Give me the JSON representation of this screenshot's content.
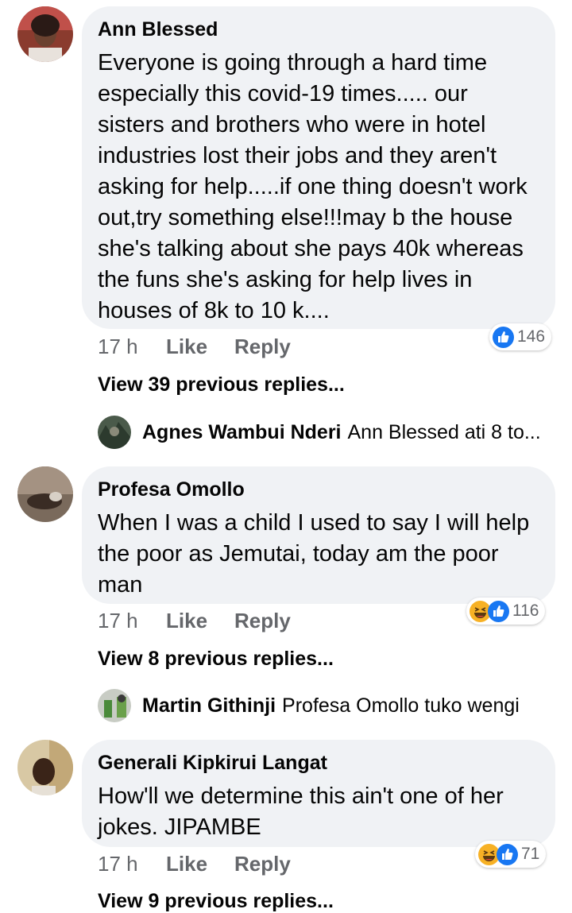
{
  "comments": [
    {
      "author": "Ann Blessed",
      "text": "Everyone is going through a hard time especially this covid-19 times..... our sisters and brothers who were in hotel industries lost their jobs and they aren't asking for help.....if one thing doesn't work out,try something else!!!may b the house she's talking about she pays 40k whereas the funs she's asking for help lives in houses of 8k to 10 k....",
      "time": "17 h",
      "like_label": "Like",
      "reply_label": "Reply",
      "reaction_count": "146",
      "reaction_icons": [
        "like-icon"
      ],
      "view_previous": "View 39 previous replies...",
      "reply_preview": {
        "author": "Agnes Wambui Nderi",
        "text": "Ann Blessed ati 8 to..."
      }
    },
    {
      "author": "Profesa Omollo",
      "text": "When I was a child I used to say I will help the poor as Jemutai, today am the poor man",
      "time": "17 h",
      "like_label": "Like",
      "reply_label": "Reply",
      "reaction_count": "116",
      "reaction_icons": [
        "haha-icon",
        "like-icon"
      ],
      "view_previous": "View 8 previous replies...",
      "reply_preview": {
        "author": "Martin Githinji",
        "text": "Profesa Omollo tuko wengi"
      }
    },
    {
      "author": "Generali Kipkirui Langat",
      "text": "How'll we determine this ain't one of her jokes. JIPAMBE",
      "time": "17 h",
      "like_label": "Like",
      "reply_label": "Reply",
      "reaction_count": "71",
      "reaction_icons": [
        "haha-icon",
        "like-icon"
      ],
      "view_previous": "View 9 previous replies..."
    }
  ],
  "colors": {
    "bubble": "#f0f2f5",
    "meta_text": "#65676b",
    "like_blue": "#1877f2",
    "haha_yellow": "#f7b125"
  }
}
